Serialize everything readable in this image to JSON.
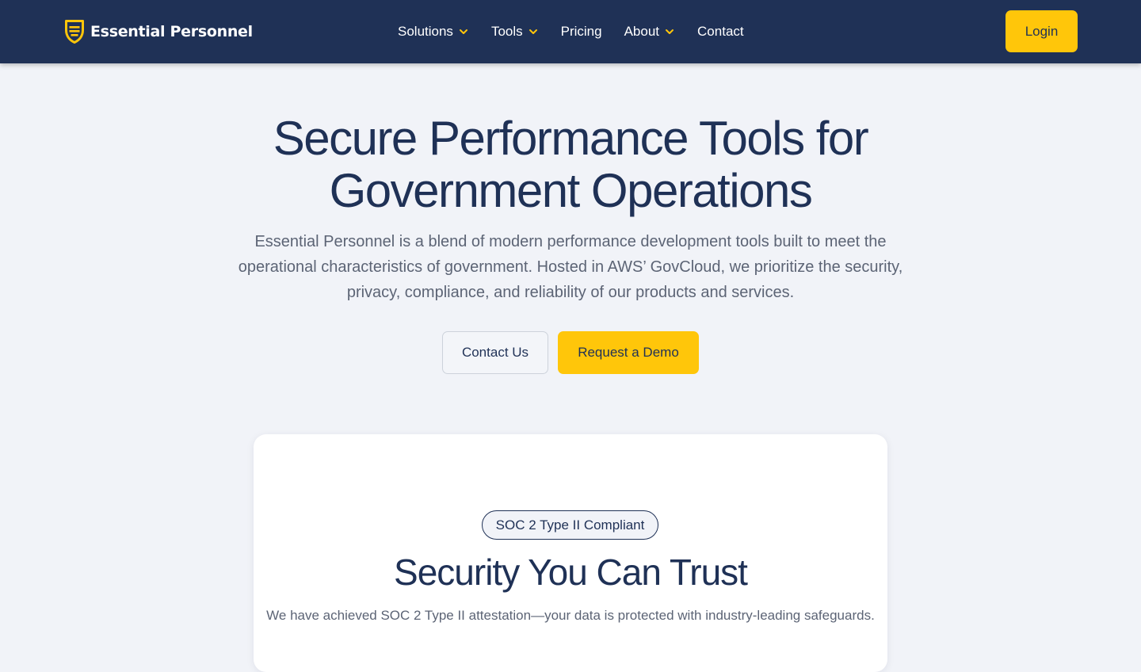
{
  "colors": {
    "navy": "#1f3156",
    "accent_yellow": "#ffc60a",
    "page_background": "#f1f3f8",
    "body_text": "#5c6475",
    "card_background": "#ffffff"
  },
  "navbar": {
    "brand": {
      "logo_icon": "shield-logo-icon",
      "name": "Essential Personnel"
    },
    "links": [
      {
        "label": "Solutions",
        "has_dropdown": true
      },
      {
        "label": "Tools",
        "has_dropdown": true
      },
      {
        "label": "Pricing",
        "has_dropdown": false
      },
      {
        "label": "About",
        "has_dropdown": true
      },
      {
        "label": "Contact",
        "has_dropdown": false
      }
    ],
    "dropdown_icon": "chevron-down-icon",
    "login_label": "Login"
  },
  "hero": {
    "title_line1": "Secure Performance Tools for",
    "title_line2": "Government Operations",
    "description": "Essential Personnel is a blend of modern performance development tools built to meet the operational characteristics of government. Hosted in AWS’ GovCloud, we prioritize the security, privacy, compliance, and reliability of our products and services.",
    "contact_button": "Contact Us",
    "demo_button": "Request a Demo"
  },
  "trust": {
    "badge": "SOC 2 Type II Compliant",
    "title": "Security You Can Trust",
    "description": "We have achieved SOC 2 Type II attestation—your data is protected with industry-leading safeguards."
  }
}
